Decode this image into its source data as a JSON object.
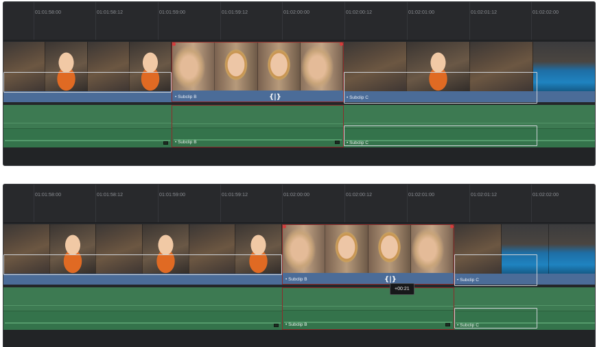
{
  "panels": [
    {
      "ruler": [
        "01:01:58:00",
        "01:01:58:12",
        "01:01:59:00",
        "01:01:59:12",
        "01:02:00:00",
        "01:02:00:12",
        "01:02:01:00",
        "01:02:01:12",
        "01:02:02:00"
      ],
      "clips": {
        "b_video": "Subclip B",
        "c_video": "Subclip C",
        "b_audio": "Subclip B",
        "c_audio": "Subclip C"
      },
      "trim_cursor": "{|}"
    },
    {
      "ruler": [
        "01:01:58:00",
        "01:01:58:12",
        "01:01:59:00",
        "01:01:59:12",
        "01:02:00:00",
        "01:02:00:12",
        "01:02:01:00",
        "01:02:01:12",
        "01:02:02:00"
      ],
      "clips": {
        "b_video": "Subclip B",
        "c_video": "Subclip C",
        "b_audio": "Subclip B",
        "c_audio": "Subclip C"
      },
      "trim_cursor": "{|}",
      "tooltip": "+00:21"
    }
  ],
  "colors": {
    "video_clip": "#4e6e9a",
    "audio_clip": "#3d7a52",
    "selection": "#8e2a2a",
    "background": "#242629"
  },
  "icons": [
    "trim-cursor-icon",
    "audio-waveform-icon"
  ]
}
